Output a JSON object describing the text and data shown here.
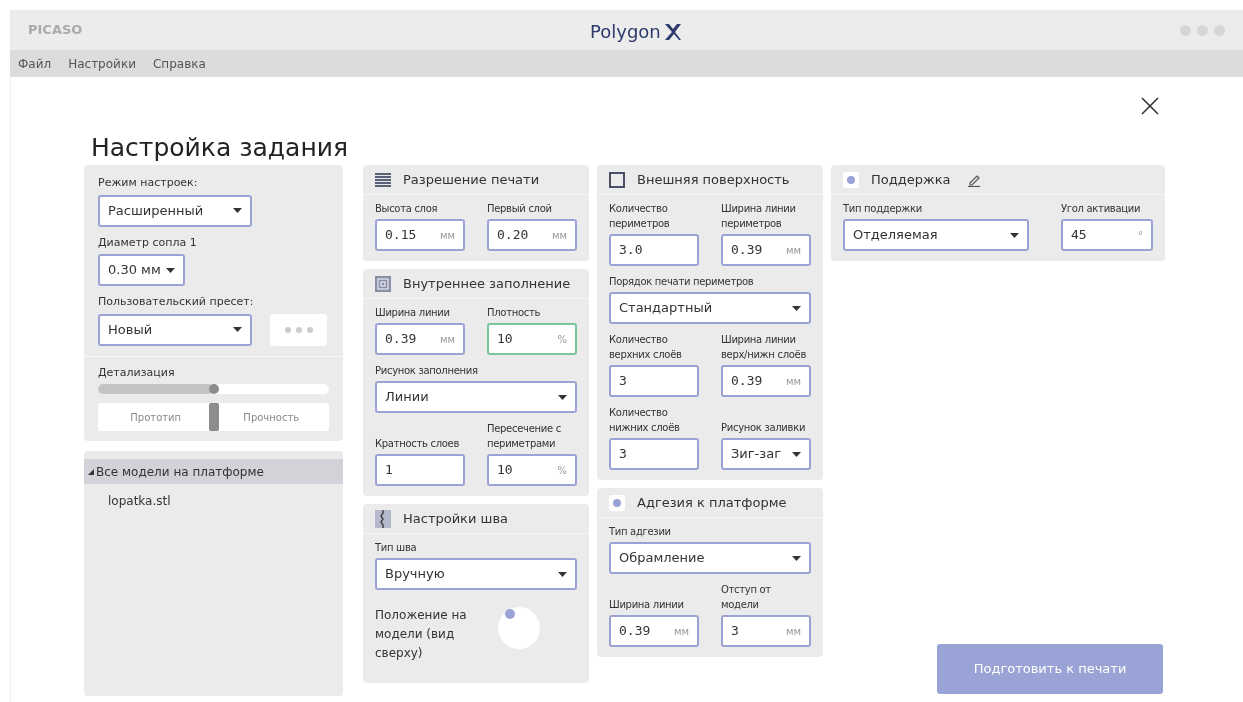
{
  "window": {
    "app_name": "PICASO",
    "logo": "Polygon"
  },
  "menu": [
    "Файл",
    "Настройки",
    "Справка"
  ],
  "title": "Настройка задания",
  "left_panel": {
    "mode": {
      "label": "Режим настроек:",
      "value": "Расширенный"
    },
    "nozzle": {
      "label": "Диаметр сопла 1",
      "value": "0.30 мм"
    },
    "preset": {
      "label": "Пользовательский пресет:",
      "value": "Новый"
    },
    "detail": {
      "label": "Детализация",
      "level": 0.5
    },
    "profile": {
      "left": "Прототип",
      "right": "Прочность",
      "level": 0.5
    }
  },
  "tree": {
    "label": "Все модели на платформе",
    "expanded": true,
    "children": [
      {
        "label": "lopatka.stl"
      }
    ]
  },
  "columns": [
    [
      {
        "title": "Разрешение печати",
        "rows": [
          [
            {
              "kind": "input",
              "label": "Высота слоя",
              "value": "0.15",
              "unit": "мм",
              "focused": false
            },
            {
              "kind": "input",
              "label": "Первый слой",
              "value": "0.20",
              "unit": "мм",
              "focused": false
            }
          ]
        ]
      },
      {
        "title": "Внутреннее заполнение",
        "rows": [
          [
            {
              "kind": "input",
              "label": "Ширина линии",
              "value": "0.39",
              "unit": "мм",
              "focused": false
            },
            {
              "kind": "input",
              "label": "Плотность",
              "value": "10",
              "unit": "%",
              "focused": true
            }
          ],
          [
            {
              "kind": "select",
              "label": "Рисунок заполнения",
              "value": "Линии"
            }
          ],
          [
            {
              "kind": "input",
              "label": "Кратность слоев",
              "value": "1",
              "focused": false
            },
            {
              "kind": "input",
              "label": "Пересечение с периметрами",
              "value": "10",
              "unit": "%",
              "focused": false
            }
          ]
        ]
      },
      {
        "title": "Настройки шва",
        "rows": [
          [
            {
              "kind": "select",
              "label": "Тип шва",
              "value": "Вручную"
            }
          ],
          [
            {
              "kind": "dial",
              "label": "Положение на модели (вид сверху)"
            }
          ]
        ]
      }
    ],
    [
      {
        "title": "Внешняя поверхность",
        "rows": [
          [
            {
              "kind": "input",
              "label": "Количество периметров",
              "value": "3.0",
              "focused": false
            },
            {
              "kind": "input",
              "label": "Ширина линии периметров",
              "value": "0.39",
              "unit": "мм",
              "focused": false
            }
          ],
          [
            {
              "kind": "select",
              "label": "Порядок печати периметров",
              "value": "Стандартный"
            }
          ],
          [
            {
              "kind": "input",
              "label": "Количество верхних слоёв",
              "value": "3",
              "focused": false
            },
            {
              "kind": "input",
              "label": "Ширина линии верх/нижн слоёв",
              "value": "0.39",
              "unit": "мм",
              "focused": false
            }
          ],
          [
            {
              "kind": "input",
              "label": "Количество нижних слоёв",
              "value": "3",
              "focused": false
            },
            {
              "kind": "select",
              "label": "Рисунок заливки",
              "value": "Зиг-заг"
            }
          ]
        ]
      },
      {
        "title": "Адгезия к платформе",
        "checked": true,
        "rows": [
          [
            {
              "kind": "select",
              "label": "Тип адгезии",
              "value": "Обрамление"
            }
          ],
          [
            {
              "kind": "input",
              "label": "Ширина линии",
              "value": "0.39",
              "unit": "мм",
              "focused": false
            },
            {
              "kind": "input",
              "label": "Отступ от модели",
              "value": "3",
              "unit": "мм",
              "focused": false
            }
          ]
        ]
      }
    ],
    [
      {
        "title": "Поддержка",
        "checked": true,
        "editable": true,
        "rows": [
          [
            {
              "kind": "select",
              "label": "Тип поддержки",
              "value": "Отделяемая"
            },
            {
              "kind": "input",
              "label": "Угол активации",
              "value": "45",
              "unit": "°",
              "focused": false
            }
          ]
        ]
      }
    ]
  ],
  "primary_button": "Подготовить к печати"
}
